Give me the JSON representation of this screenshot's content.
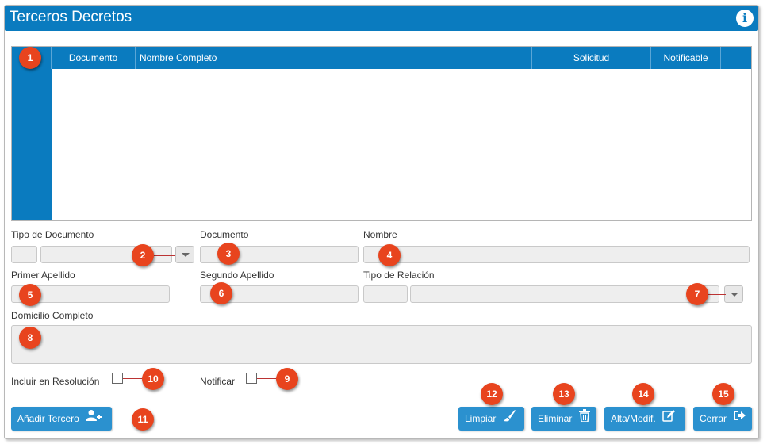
{
  "window": {
    "title": "Terceros Decretos",
    "info_icon": "i"
  },
  "grid": {
    "columns": [
      "Documento",
      "Nombre Completo",
      "Solicitud",
      "Notificable"
    ]
  },
  "form": {
    "tipo_documento_label": "Tipo de Documento",
    "documento_label": "Documento",
    "nombre_label": "Nombre",
    "primer_apellido_label": "Primer Apellido",
    "segundo_apellido_label": "Segundo Apellido",
    "tipo_relacion_label": "Tipo de Relación",
    "domicilio_label": "Domicilio Completo",
    "incluir_label": "Incluir en Resolución",
    "notificar_label": "Notificar"
  },
  "buttons": {
    "add_label": "Añadir Tercero",
    "clear_label": "Limpiar",
    "delete_label": "Eliminar",
    "save_label": "Alta/Modif.",
    "close_label": "Cerrar"
  },
  "callouts": [
    "1",
    "2",
    "3",
    "4",
    "5",
    "6",
    "7",
    "8",
    "9",
    "10",
    "11",
    "12",
    "13",
    "14",
    "15"
  ]
}
